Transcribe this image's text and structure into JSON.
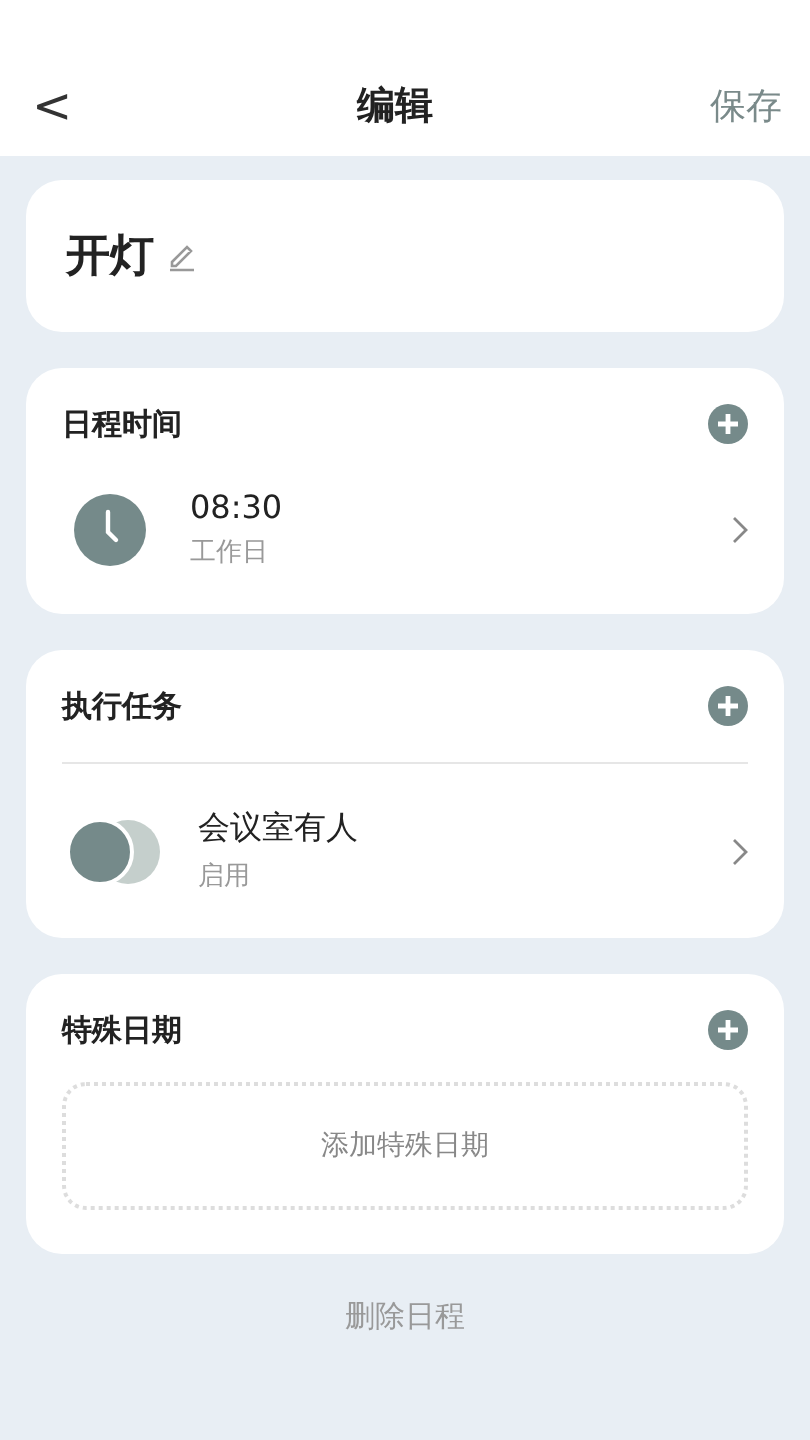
{
  "header": {
    "back": "<",
    "title": "编辑",
    "save": "保存"
  },
  "name_card": {
    "name": "开灯"
  },
  "sections": [
    {
      "title": "日程时间",
      "divider": false,
      "kind": "list",
      "items": [
        {
          "kind": "clock",
          "primary": "08:30",
          "secondary": "工作日"
        }
      ]
    },
    {
      "title": "执行任务",
      "divider": true,
      "kind": "list",
      "items": [
        {
          "kind": "scene",
          "primary": "会议室有人",
          "secondary": "启用"
        }
      ]
    },
    {
      "title": "特殊日期",
      "divider": false,
      "kind": "empty",
      "add_label": "添加特殊日期"
    }
  ],
  "delete_button": "删除日程"
}
